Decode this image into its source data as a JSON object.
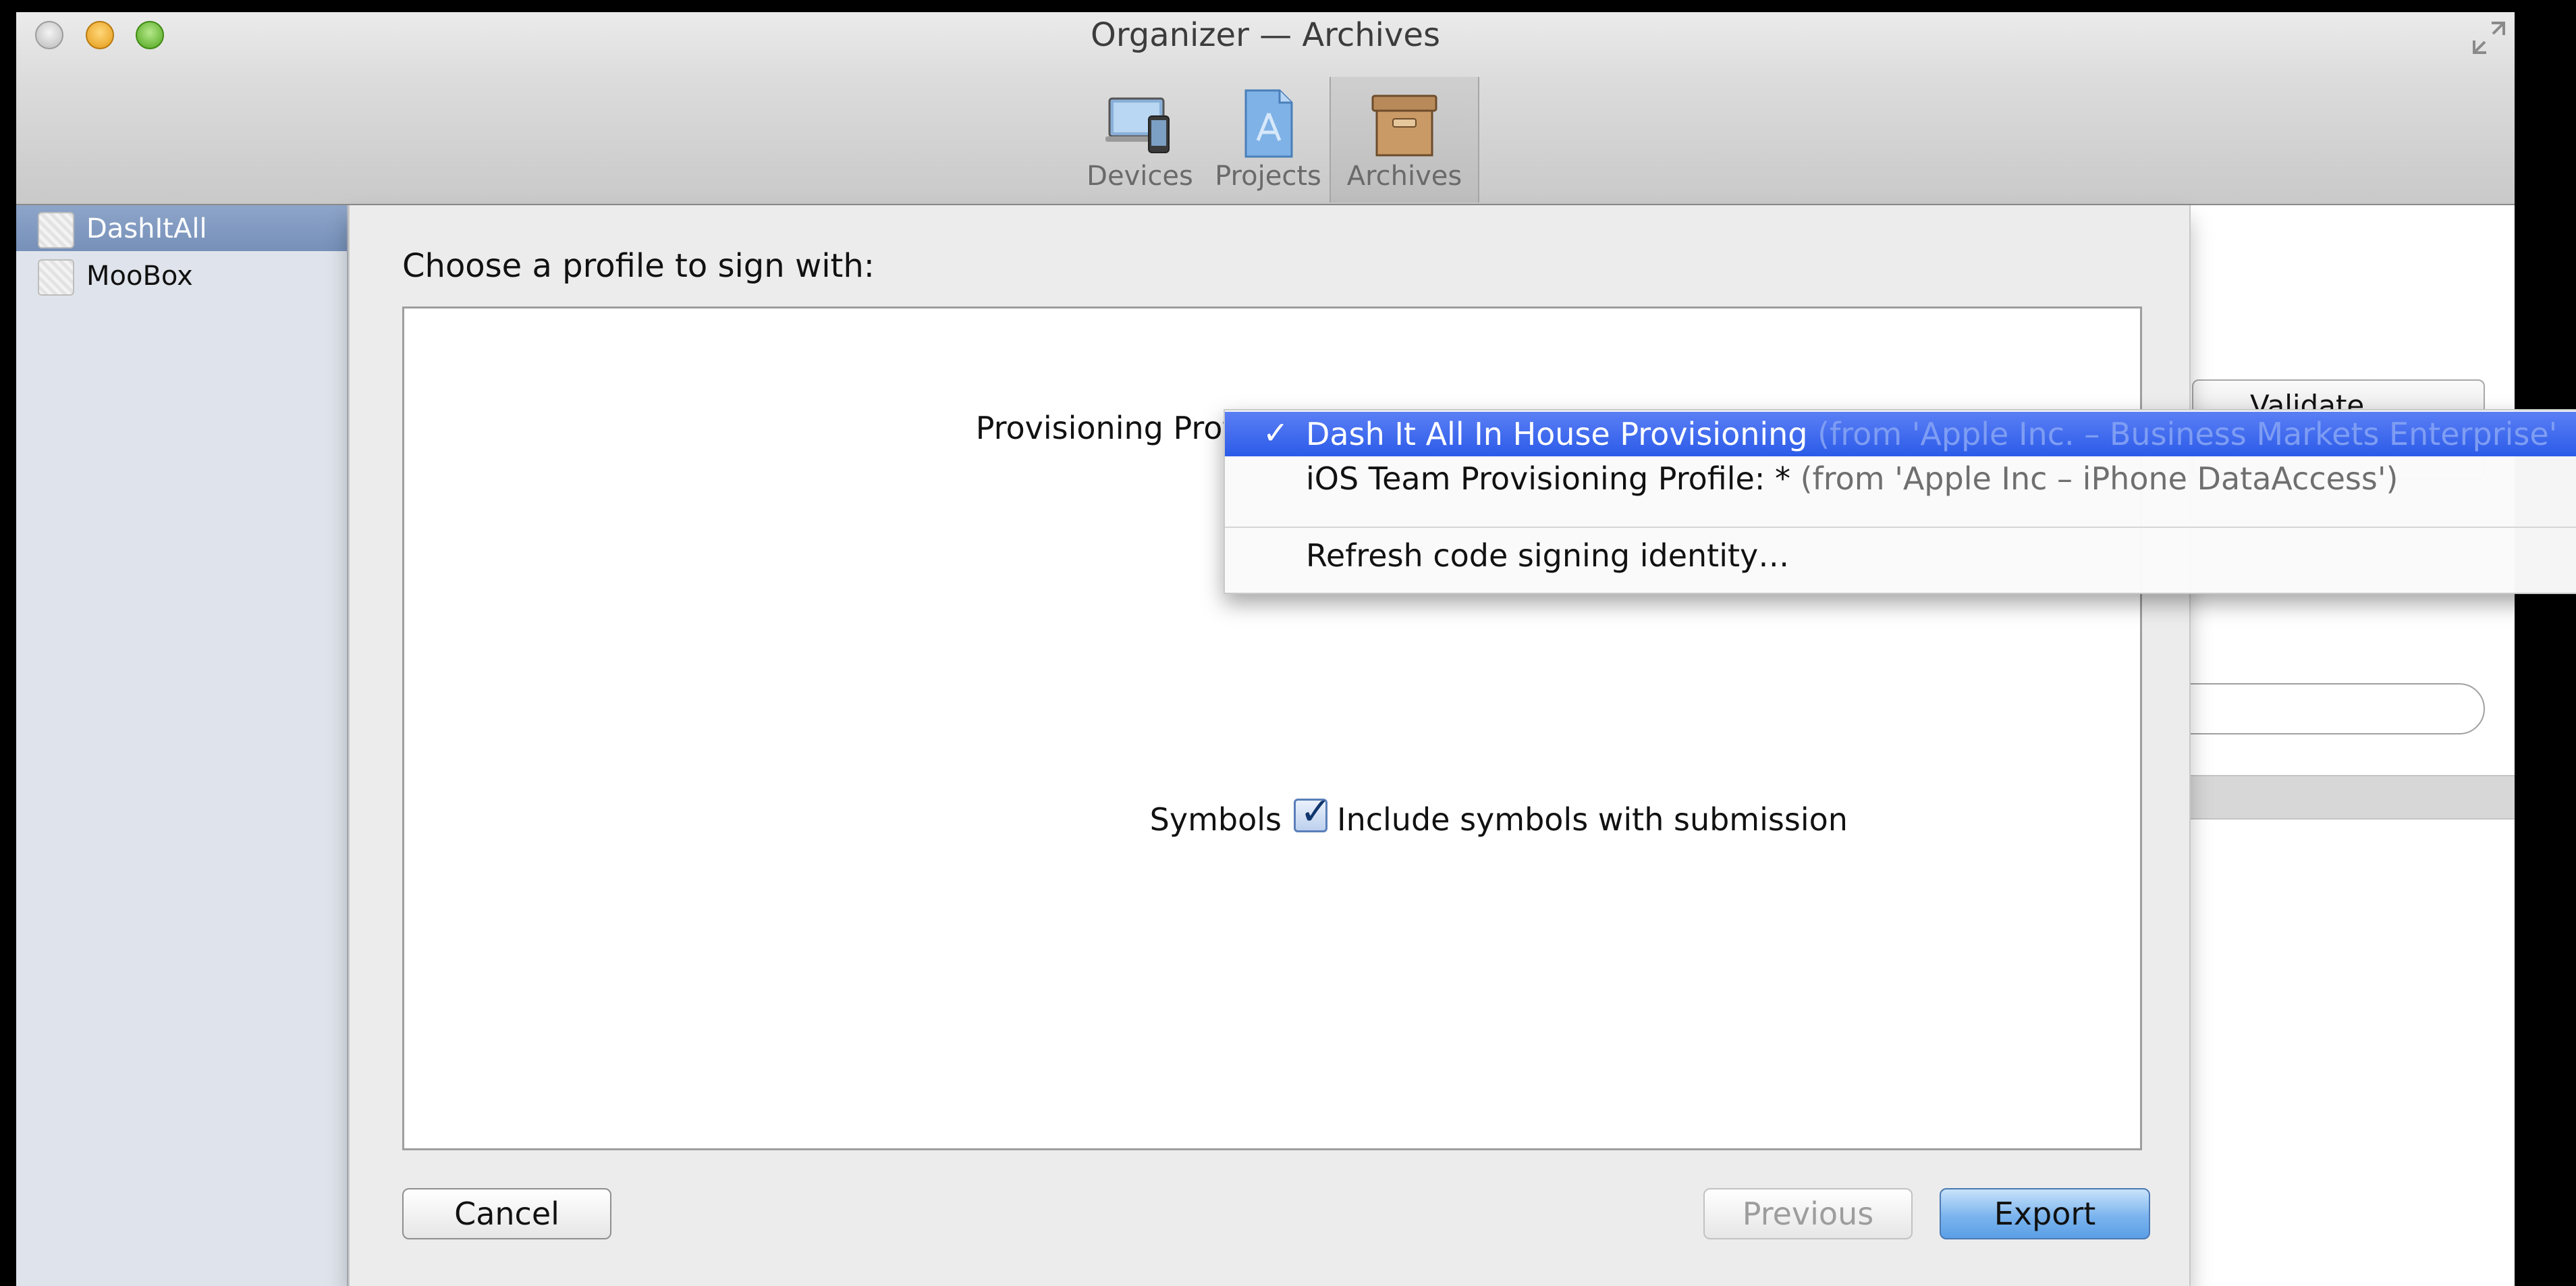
{
  "window": {
    "title": "Organizer — Archives"
  },
  "toolbar": {
    "items": [
      {
        "label": "Devices",
        "icon": "devices-icon",
        "selected": false
      },
      {
        "label": "Projects",
        "icon": "projects-icon",
        "selected": false
      },
      {
        "label": "Archives",
        "icon": "archives-icon",
        "selected": true
      }
    ]
  },
  "sidebar": {
    "items": [
      {
        "label": "DashItAll",
        "selected": true
      },
      {
        "label": "MooBox",
        "selected": false
      }
    ]
  },
  "background": {
    "validate_label": "Validate..."
  },
  "sheet": {
    "heading": "Choose a profile to sign with:",
    "provisioning_label": "Provisioning Profile:",
    "symbols_label": "Symbols",
    "symbols_checkbox_label": "Include symbols with submission",
    "symbols_checked": true,
    "buttons": {
      "cancel": "Cancel",
      "previous": "Previous",
      "export": "Export"
    }
  },
  "popup_menu": {
    "items": [
      {
        "check": "✓",
        "label": "Dash It All In House Provisioning",
        "source": "(from 'Apple Inc. – Business Markets Enterprise'",
        "selected": true
      },
      {
        "label": "iOS Team Provisioning Profile: *",
        "source": "(from 'Apple Inc – iPhone DataAccess')",
        "selected": false
      },
      {
        "label": "Refresh code signing identity…",
        "selected": false
      }
    ]
  },
  "colors": {
    "menu_highlight": "#2b5be8",
    "sidebar_selection": "#7690b9",
    "export_button": "#6aa9ea"
  }
}
